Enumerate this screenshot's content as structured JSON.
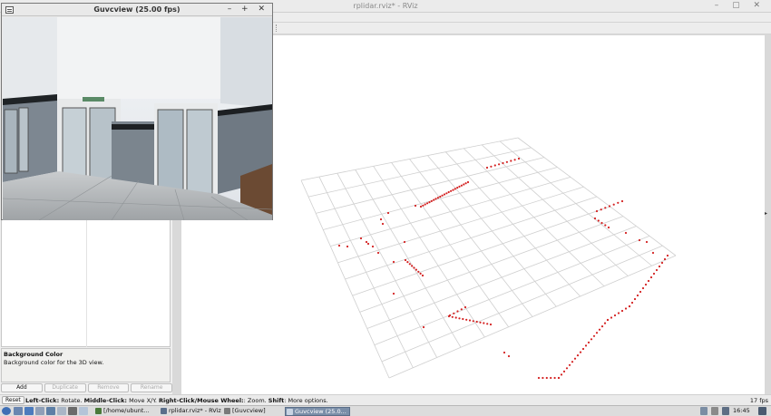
{
  "rviz": {
    "title": "rplidar.rviz* - RViz",
    "window_controls": "– ▢ ✕",
    "property_description": {
      "title": "Background Color",
      "text": "Background color for the 3D view."
    },
    "buttons": {
      "add": "Add",
      "duplicate": "Duplicate",
      "remove": "Remove",
      "rename": "Rename"
    },
    "status": {
      "reset": "Reset",
      "hint_1b": "Left-Click:",
      "hint_1": " Rotate. ",
      "hint_2b": "Middle-Click:",
      "hint_2": " Move X/Y. ",
      "hint_3b": "Right-Click/Mouse Wheel:",
      "hint_3": ": Zoom. ",
      "hint_4b": "Shift",
      "hint_4": ": More options.",
      "fps": "17 fps"
    }
  },
  "guvcview": {
    "title": "Guvcview  (25.00 fps)",
    "window_controls": "– + ✕"
  },
  "taskbar": {
    "items": [
      {
        "label": "[/home/ubunt...",
        "color": "#4a7a3a"
      },
      {
        "label": "rplidar.rviz* - RViz",
        "color": "#5a6e8a"
      },
      {
        "label": "[Guvcview]",
        "color": "#7a7a7a"
      },
      {
        "label": "Guvcview  (25.0...",
        "color": "#6a7f9c"
      }
    ],
    "clock": "16:45"
  },
  "colors": {
    "lidar_points": "#d42222",
    "grid_lines": "#cfcfcf"
  }
}
